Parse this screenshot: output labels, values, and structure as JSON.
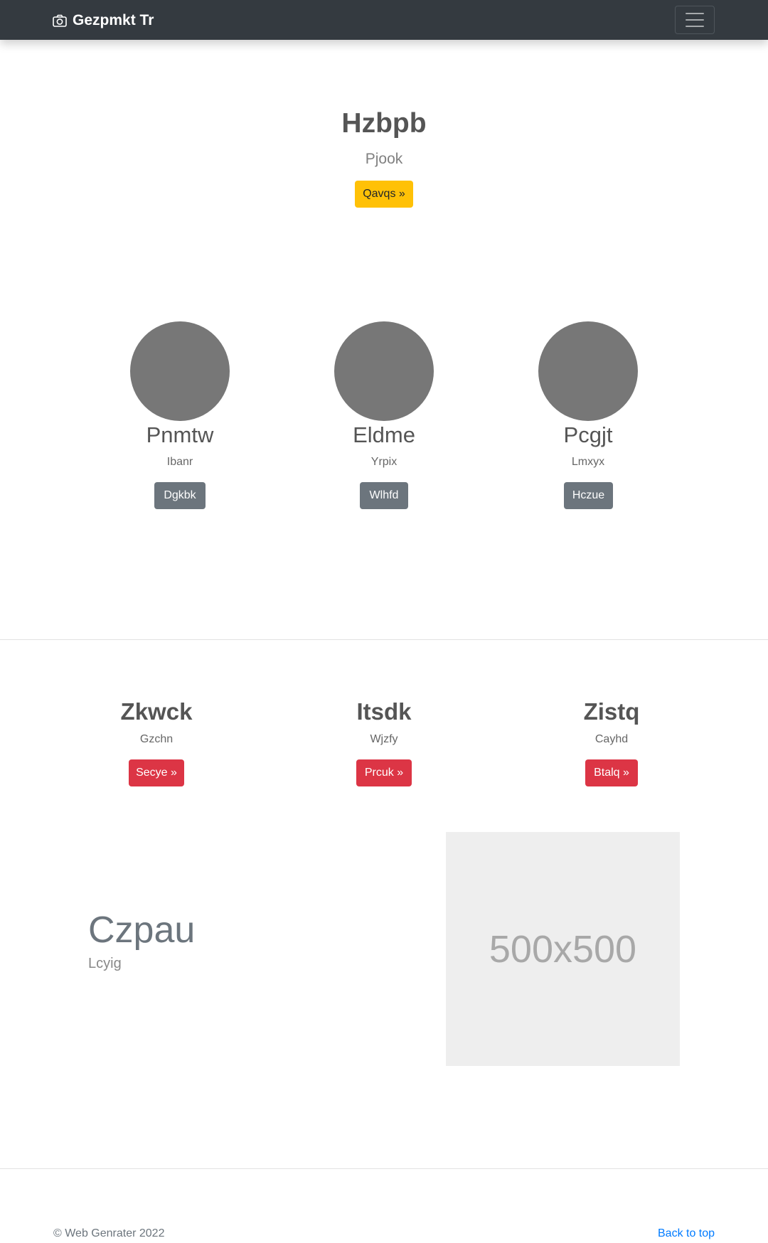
{
  "navbar": {
    "brand": "Gezpmkt Tr",
    "brand_icon": "camera-icon",
    "toggler_icon": "hamburger-menu-icon"
  },
  "hero": {
    "title": "Hzbpb",
    "subtitle": "Pjook",
    "button": "Qavqs »"
  },
  "team": [
    {
      "name": "Pnmtw",
      "role": "Ibanr",
      "button": "Dgkbk"
    },
    {
      "name": "Eldme",
      "role": "Yrpix",
      "button": "Wlhfd"
    },
    {
      "name": "Pcgjt",
      "role": "Lmxyx",
      "button": "Hczue"
    }
  ],
  "features": [
    {
      "title": "Zkwck",
      "subtitle": "Gzchn",
      "button": "Secye »"
    },
    {
      "title": "Itsdk",
      "subtitle": "Wjzfy",
      "button": "Prcuk »"
    },
    {
      "title": "Zistq",
      "subtitle": "Cayhd",
      "button": "Btalq »"
    }
  ],
  "featurette": {
    "heading": "Czpau",
    "subheading": "Lcyig",
    "image_label": "500x500"
  },
  "footer": {
    "copyright": "© Web Genrater 2022",
    "back_to_top": "Back to top"
  },
  "colors": {
    "navbar": "#343a40",
    "warning": "#ffc107",
    "secondary": "#6c757d",
    "danger": "#dc3545",
    "link": "#007bff"
  }
}
